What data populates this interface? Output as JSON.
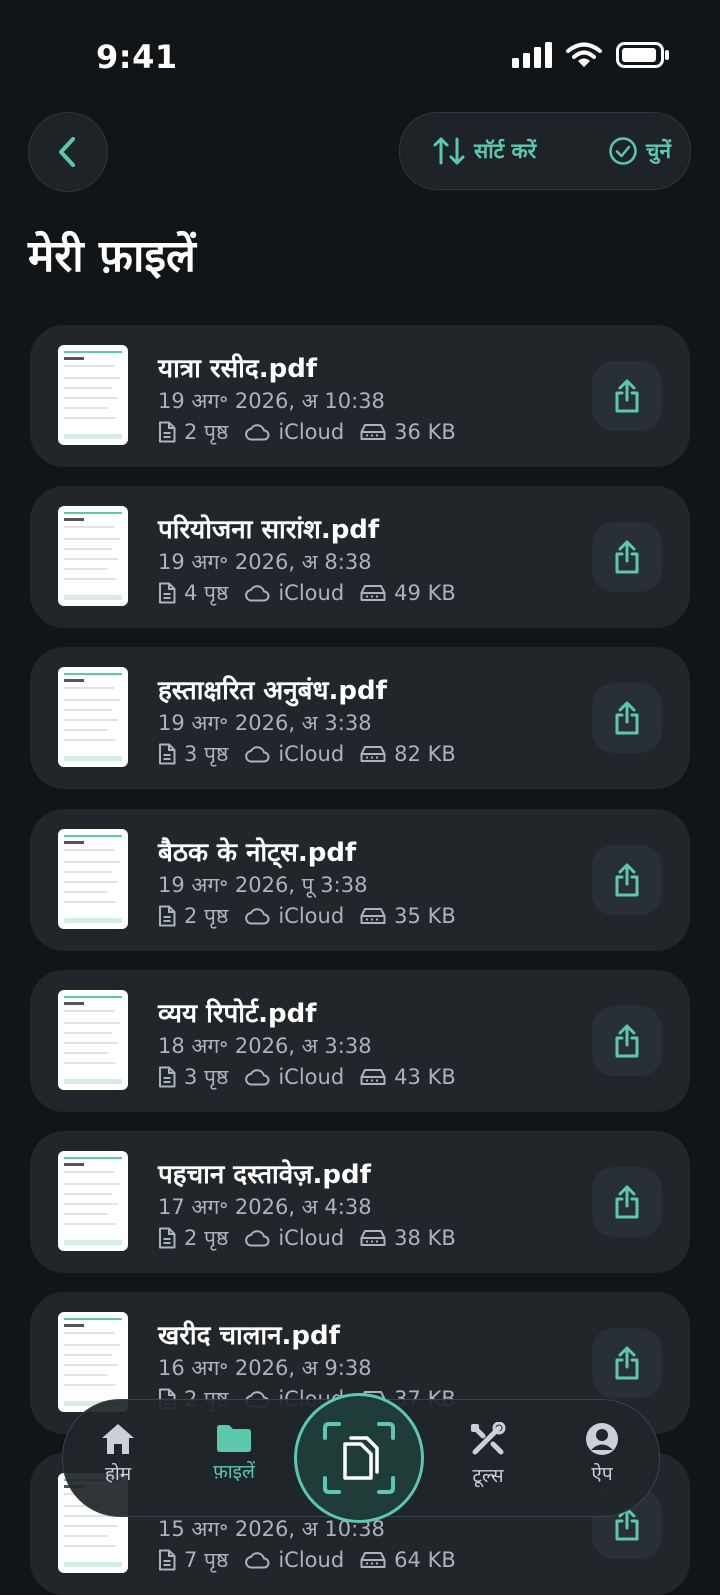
{
  "status_bar": {
    "time": "9:41"
  },
  "header": {
    "sort_label": "सॉर्ट करें",
    "select_label": "चुनें",
    "title": "मेरी फ़ाइलें"
  },
  "files": [
    {
      "name": "यात्रा रसीद.pdf",
      "date": "19 अग॰ 2026, अ 10:38",
      "pages": "2 पृष्ठ",
      "storage": "iCloud",
      "size": "36 KB"
    },
    {
      "name": "परियोजना सारांश.pdf",
      "date": "19 अग॰ 2026, अ 8:38",
      "pages": "4 पृष्ठ",
      "storage": "iCloud",
      "size": "49 KB"
    },
    {
      "name": "हस्ताक्षरित अनुबंध.pdf",
      "date": "19 अग॰ 2026, अ 3:38",
      "pages": "3 पृष्ठ",
      "storage": "iCloud",
      "size": "82 KB"
    },
    {
      "name": "बैठक के नोट्स.pdf",
      "date": "19 अग॰ 2026, पू 3:38",
      "pages": "2 पृष्ठ",
      "storage": "iCloud",
      "size": "35 KB"
    },
    {
      "name": "व्यय रिपोर्ट.pdf",
      "date": "18 अग॰ 2026, अ 3:38",
      "pages": "3 पृष्ठ",
      "storage": "iCloud",
      "size": "43 KB"
    },
    {
      "name": "पहचान दस्तावेज़.pdf",
      "date": "17 अग॰ 2026, अ 4:38",
      "pages": "2 पृष्ठ",
      "storage": "iCloud",
      "size": "38 KB"
    },
    {
      "name": "खरीद चालान.pdf",
      "date": "16 अग॰ 2026, अ 9:38",
      "pages": "2 पृष्ठ",
      "storage": "iCloud",
      "size": "37 KB"
    },
    {
      "name": "",
      "date": "15 अग॰ 2026, अ 10:38",
      "pages": "7 पृष्ठ",
      "storage": "iCloud",
      "size": "64 KB"
    }
  ],
  "nav": {
    "home": "होम",
    "files": "फ़ाइलें",
    "tools": "टूल्स",
    "apps": "ऐप"
  }
}
